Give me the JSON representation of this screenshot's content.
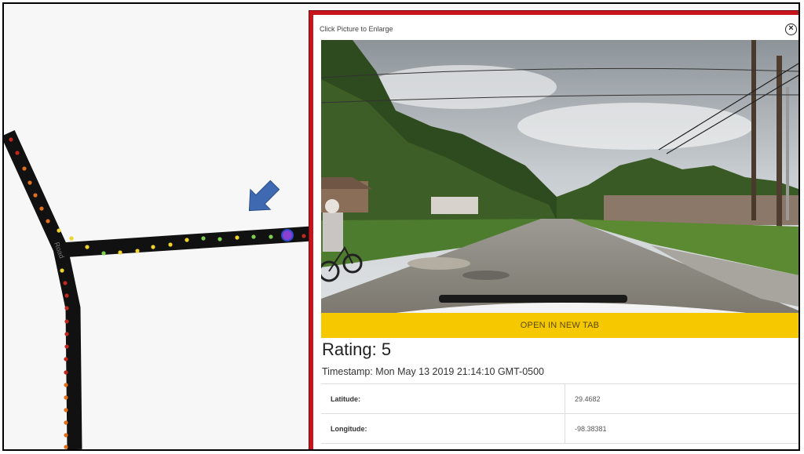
{
  "popup": {
    "hint": "Click Picture to Enlarge",
    "close_icon": "close-circle-icon",
    "open_button": "OPEN IN NEW TAB",
    "rating": "Rating: 5",
    "timestamp": "Timestamp: Mon May 13 2019 21:14:10 GMT-0500",
    "details": [
      {
        "label": "Latitude:",
        "value": "29.4682"
      },
      {
        "label": "Longitude:",
        "value": "-98.38381"
      }
    ]
  },
  "map": {
    "road_label": "Road",
    "marker_colors": {
      "red": "#c0281e",
      "orange": "#e0701c",
      "yellow": "#f1d32a",
      "green": "#7dcf52",
      "selected": "#2a4cd0"
    },
    "pointer_icon": "arrow-down-right-icon"
  },
  "colors": {
    "accent_border": "#c8141c",
    "button": "#f5c800"
  }
}
